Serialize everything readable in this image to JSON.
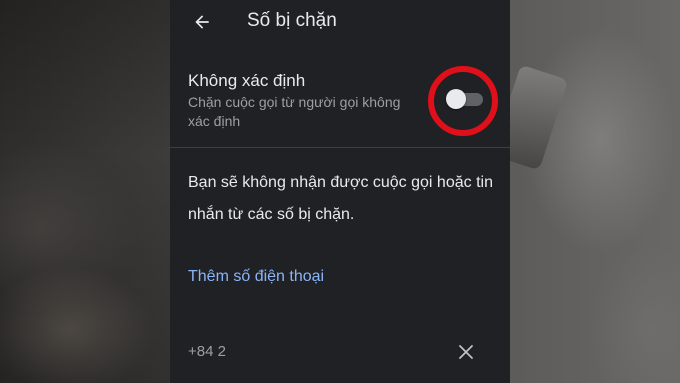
{
  "header": {
    "title": "Số bị chặn",
    "back_icon": "arrow-back-icon"
  },
  "unknown_callers": {
    "title": "Không xác định",
    "description": "Chặn cuộc gọi từ người gọi không xác định",
    "toggle_on": false
  },
  "info": {
    "text": "Bạn sẽ không nhận được cuộc gọi hoặc tin nhắn từ các số bị chặn."
  },
  "add_number": {
    "label": "Thêm số điện thoại"
  },
  "blocked_numbers": [
    {
      "number": "+84 2",
      "remove_icon": "close-icon"
    }
  ],
  "colors": {
    "panel_background": "#202124",
    "primary_text": "#e8eaed",
    "secondary_text": "#9aa0a6",
    "link": "#8ab4f8",
    "highlight_ring": "#e0101a"
  }
}
